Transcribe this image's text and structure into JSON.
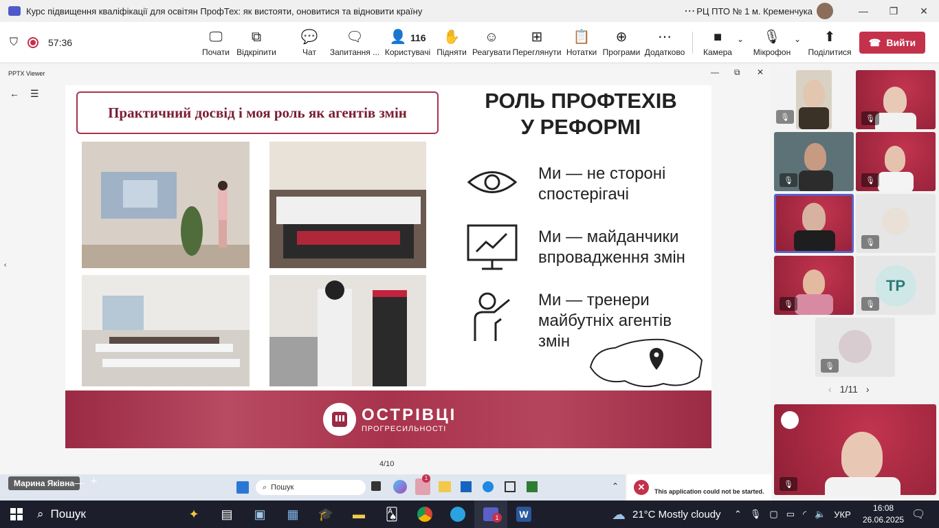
{
  "window": {
    "title": "Курс підвищення кваліфікації для освітян ПрофТех: як вистояти, оновитися та відновити країну",
    "org": "РЦ ПТО № 1 м. Кременчука"
  },
  "toolbar": {
    "timer": "57:36",
    "items": [
      {
        "label": "Почати"
      },
      {
        "label": "Відкріпити"
      },
      {
        "label": "Чат"
      },
      {
        "label": "Запитання ..."
      },
      {
        "label": "Користувачі",
        "count": "116"
      },
      {
        "label": "Підняти"
      },
      {
        "label": "Реагувати"
      },
      {
        "label": "Переглянути"
      },
      {
        "label": "Нотатки"
      },
      {
        "label": "Програми"
      },
      {
        "label": "Додатково"
      },
      {
        "label": "Камера"
      },
      {
        "label": "Мікрофон"
      },
      {
        "label": "Поділитися"
      }
    ],
    "leave_label": "Вийти"
  },
  "viewer": {
    "title": "PPTX Viewer",
    "page": "4/10"
  },
  "slide": {
    "left_title": "Практичний досвід і моя роль як агентів змін",
    "right_title_line1": "РОЛЬ ПРОФТЕХІВ",
    "right_title_line2": "У РЕФОРМІ",
    "items": [
      {
        "line1": "Ми — не стороні",
        "line2": "спостерігачі",
        "line3": ""
      },
      {
        "line1": "Ми — майданчики",
        "line2": "впровадження змін",
        "line3": ""
      },
      {
        "line1": "Ми — тренери",
        "line2": "майбутніх агентів",
        "line3": "змін"
      }
    ],
    "footer_big": "ОСТРІВЦІ",
    "footer_small": "ПРОГРЕСИЛЬНОСТІ"
  },
  "gallery": {
    "tiles": [
      {
        "type": "photo"
      },
      {
        "type": "photo"
      },
      {
        "type": "photo"
      },
      {
        "type": "photo"
      },
      {
        "type": "photo",
        "active": true
      },
      {
        "type": "photo"
      },
      {
        "type": "photo"
      },
      {
        "type": "initials",
        "initials": "TP"
      },
      {
        "type": "photo"
      }
    ],
    "pager": "1/11"
  },
  "inner_taskbar": {
    "presenter_name": "Марина Яківна",
    "search_placeholder": "Пошук",
    "badge": "1"
  },
  "toast": {
    "message": "This application could not be started."
  },
  "taskbar": {
    "search_label": "Пошук",
    "weather": "21°C  Mostly cloudy",
    "lang": "УКР",
    "time": "16:08",
    "date": "26.06.2025",
    "badge": "1"
  },
  "colors": {
    "accent": "#c4314b",
    "slide_red": "#9b2a44",
    "teams": "#5059c9"
  }
}
